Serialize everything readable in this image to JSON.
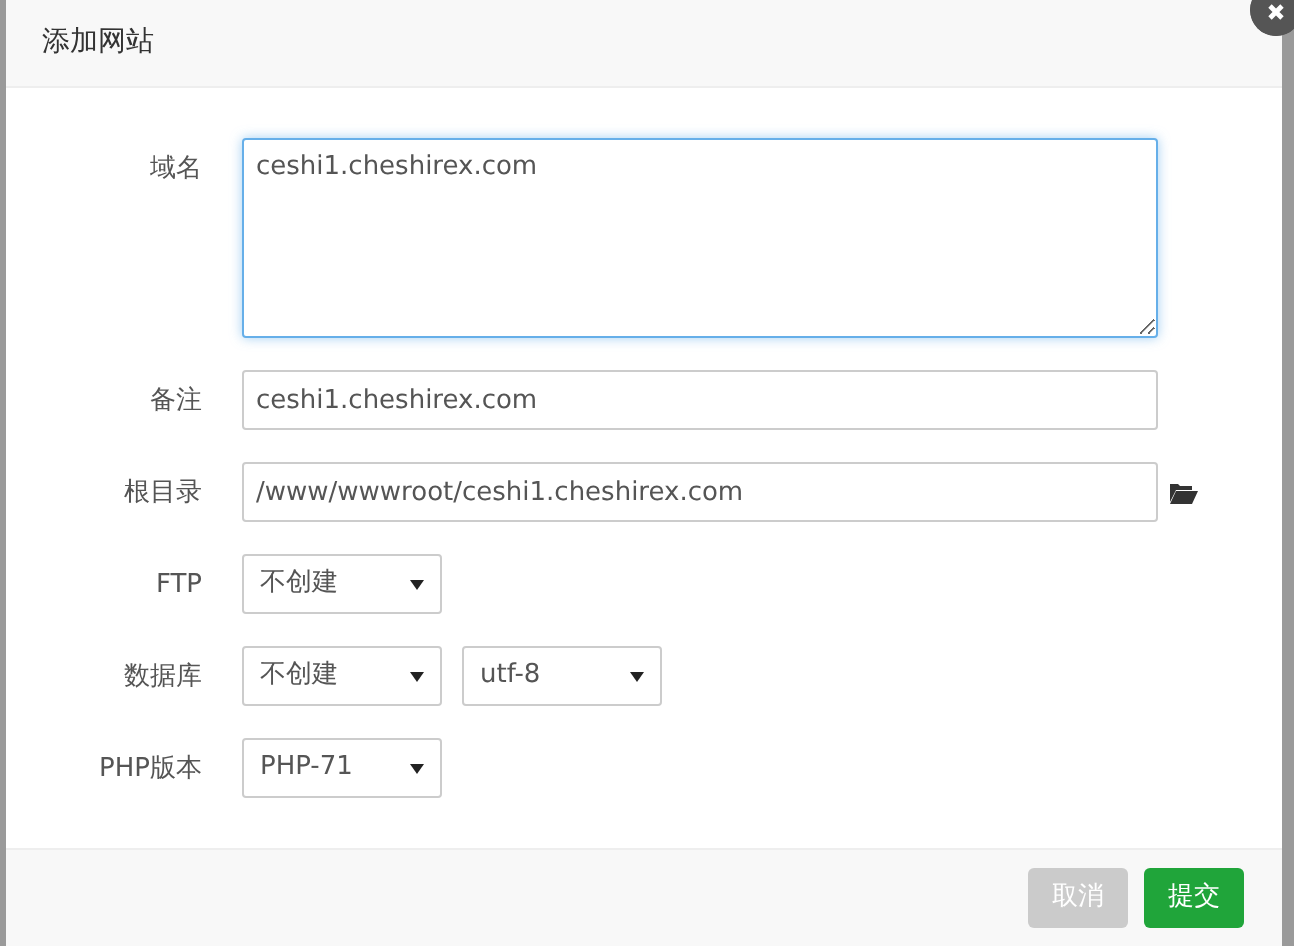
{
  "dialog": {
    "title": "添加网站"
  },
  "fields": [
    {
      "kind": "textarea",
      "label": "域名",
      "value": "ceshi1.cheshirex.com",
      "focused": true
    },
    {
      "kind": "input",
      "label": "备注",
      "value": "ceshi1.cheshirex.com",
      "focused": false
    },
    {
      "kind": "path",
      "label": "根目录",
      "value": "/www/wwwroot/ceshi1.cheshirex.com",
      "focused": false
    },
    {
      "kind": "select",
      "label": "FTP",
      "selects": [
        "不创建"
      ]
    },
    {
      "kind": "select",
      "label": "数据库",
      "selects": [
        "不创建",
        "utf-8"
      ]
    },
    {
      "kind": "select",
      "label": "PHP版本",
      "selects": [
        "PHP-71"
      ]
    }
  ],
  "buttons": [
    {
      "label": "取消",
      "kind": "cancel"
    },
    {
      "label": "提交",
      "kind": "submit"
    }
  ]
}
